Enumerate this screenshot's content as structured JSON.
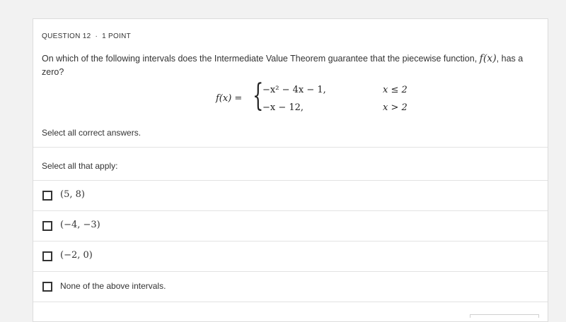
{
  "question": {
    "number_label": "QUESTION 12",
    "separator": "·",
    "points_label": "1 POINT",
    "text_before": "On which of the following intervals does the Intermediate Value Theorem guarantee that the piecewise function, ",
    "function_name": "f(x)",
    "text_after": ", has a zero?",
    "equation": {
      "lhs": "f(x) =",
      "case1_expr": "−x² − 4x − 1,",
      "case1_cond": "x ≤ 2",
      "case2_expr": "−x − 12,",
      "case2_cond": "x > 2"
    },
    "instruction": "Select all correct answers."
  },
  "answers": {
    "prompt": "Select all that apply:",
    "options": [
      {
        "label": "(5, 8)",
        "checked": false
      },
      {
        "label": "(−4, −3)",
        "checked": false
      },
      {
        "label": "(−2, 0)",
        "checked": false
      },
      {
        "label": "None of the above intervals.",
        "checked": false
      }
    ]
  },
  "colors": {
    "page_background": "#f2f2f2",
    "card_background": "#ffffff",
    "text": "#333333",
    "divider": "#e2e2e2"
  }
}
